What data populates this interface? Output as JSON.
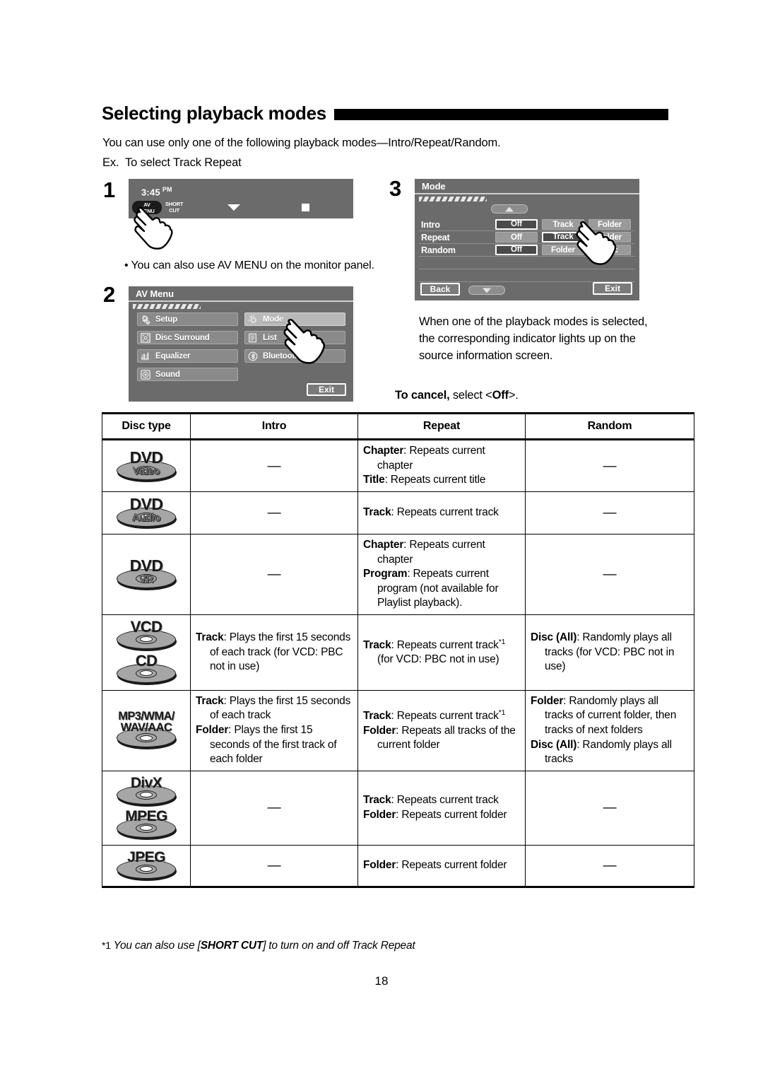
{
  "heading": {
    "title": "Selecting playback modes"
  },
  "intro": {
    "line1": "You can use only one of the following playback modes—Intro/Repeat/Random.",
    "ex_label": "Ex.",
    "ex_text": "To select Track Repeat"
  },
  "steps": {
    "one": "1",
    "two": "2",
    "three": "3"
  },
  "step1": {
    "clock_time": "3:45",
    "clock_ampm": "PM",
    "key_avmenu_line1": "AV",
    "key_avmenu_line2": "MENU",
    "key_shortcut_line1": "SHORT",
    "key_shortcut_line2": "CUT",
    "note": "• You can also use AV MENU on the monitor panel."
  },
  "step2": {
    "title": "AV Menu",
    "left_items": [
      {
        "label": "Setup",
        "icon": "gears-icon",
        "highlighted": false
      },
      {
        "label": "Disc Surround",
        "icon": "surround-icon",
        "highlighted": false
      },
      {
        "label": "Equalizer",
        "icon": "equalizer-icon",
        "highlighted": false
      },
      {
        "label": "Sound",
        "icon": "speaker-icon",
        "highlighted": false
      }
    ],
    "right_items": [
      {
        "label": "Mode",
        "icon": "brightness-icon",
        "highlighted": true
      },
      {
        "label": "List",
        "icon": "list-icon",
        "highlighted": false
      },
      {
        "label": "Bluetooth",
        "icon": "bluetooth-icon",
        "highlighted": false
      }
    ],
    "exit_label": "Exit"
  },
  "step3": {
    "title": "Mode",
    "rows": [
      {
        "name": "Intro",
        "options": [
          "Off",
          "Track",
          "Folder"
        ],
        "selected": "Off"
      },
      {
        "name": "Repeat",
        "options": [
          "Off",
          "Track",
          "Folder"
        ],
        "selected": "Track"
      },
      {
        "name": "Random",
        "options": [
          "Off",
          "Folder",
          "Disc"
        ],
        "selected": "Off"
      }
    ],
    "back_label": "Back",
    "exit_label": "Exit"
  },
  "notes": {
    "paragraph": "When one of the playback modes is selected, the corresponding indicator lights up on the source information screen.",
    "cancel_bold": "To cancel,",
    "cancel_rest": " select <",
    "cancel_value": "Off",
    "cancel_tail": ">."
  },
  "table": {
    "headers": [
      "Disc type",
      "Intro",
      "Repeat",
      "Random"
    ],
    "rows": [
      {
        "discs": [
          {
            "label": "DVD",
            "sub": "Video",
            "type": "oval"
          }
        ],
        "intro": [],
        "intro_dash": true,
        "repeat": [
          {
            "kw": "Chapter",
            "text": ": Repeats current chapter"
          },
          {
            "kw": "Title",
            "text": ": Repeats current title"
          }
        ],
        "random": [],
        "random_dash": true
      },
      {
        "discs": [
          {
            "label": "DVD",
            "sub": "Audio",
            "type": "oval"
          }
        ],
        "intro": [],
        "intro_dash": true,
        "repeat": [
          {
            "kw": "Track",
            "text": ": Repeats current track"
          }
        ],
        "random": [],
        "random_dash": true
      },
      {
        "discs": [
          {
            "label": "DVD",
            "sub": "VR",
            "type": "oval"
          }
        ],
        "intro": [],
        "intro_dash": true,
        "repeat": [
          {
            "kw": "Chapter",
            "text": ": Repeats current chapter"
          },
          {
            "kw": "Program",
            "text": ": Repeats current program (not available for Playlist playback)."
          }
        ],
        "random": [],
        "random_dash": true
      },
      {
        "discs": [
          {
            "label": "VCD",
            "sub": "",
            "type": "disc"
          },
          {
            "label": "CD",
            "sub": "",
            "type": "disc"
          }
        ],
        "intro": [
          {
            "kw": "Track",
            "text": ": Plays the first 15 seconds of each track (for VCD: PBC not in use)"
          }
        ],
        "intro_dash": false,
        "repeat": [
          {
            "kw": "Track",
            "text": ": Repeats current track",
            "sup": "*1",
            "text_after": " (for VCD: PBC not in use)"
          }
        ],
        "random": [
          {
            "kw": "Disc (All)",
            "text": ": Randomly plays all tracks (for VCD: PBC not in use)"
          }
        ],
        "random_dash": false
      },
      {
        "discs": [
          {
            "label": "MP3/WMA/",
            "label2": "WAV/AAC",
            "sub": "",
            "type": "disc"
          }
        ],
        "intro": [
          {
            "kw": "Track",
            "text": ": Plays the first 15 seconds of each track"
          },
          {
            "kw": "Folder",
            "text": ": Plays the first 15 seconds of the first track of each folder"
          }
        ],
        "intro_dash": false,
        "repeat": [
          {
            "kw": "Track",
            "text": ": Repeats current track",
            "sup": "*1"
          },
          {
            "kw": "Folder",
            "text": ": Repeats all tracks of the current folder"
          }
        ],
        "random": [
          {
            "kw": "Folder",
            "text": ": Randomly plays all tracks of current folder, then tracks of next folders"
          },
          {
            "kw": "Disc (All)",
            "text": ": Randomly plays all tracks"
          }
        ],
        "random_dash": false
      },
      {
        "discs": [
          {
            "label": "DivX",
            "sub": "",
            "type": "disc"
          },
          {
            "label": "MPEG",
            "sub": "",
            "type": "disc"
          }
        ],
        "intro": [],
        "intro_dash": true,
        "repeat": [
          {
            "kw": "Track",
            "text": ": Repeats current track"
          },
          {
            "kw": "Folder",
            "text": ": Repeats current folder"
          }
        ],
        "random": [],
        "random_dash": true
      },
      {
        "discs": [
          {
            "label": "JPEG",
            "sub": "",
            "type": "disc"
          }
        ],
        "intro": [],
        "intro_dash": true,
        "repeat": [
          {
            "kw": "Folder",
            "text": ": Repeats current folder"
          }
        ],
        "random": [],
        "random_dash": true
      }
    ],
    "dash": "—"
  },
  "footnote": {
    "mark": "*1",
    "pre": " You can also use ",
    "bracket_open": "[",
    "bold": "SHORT CUT",
    "bracket_close": "]",
    "post": " to turn on and off Track Repeat"
  },
  "page_number": "18",
  "colors": {
    "panel_bg": "#6b6b6b",
    "button_bg": "#8a8a8a",
    "button_hl": "#b9b9b9",
    "selected_bg": "#4a4a4a",
    "ink": "#000000",
    "disc_gray": "#a6a6a6"
  }
}
